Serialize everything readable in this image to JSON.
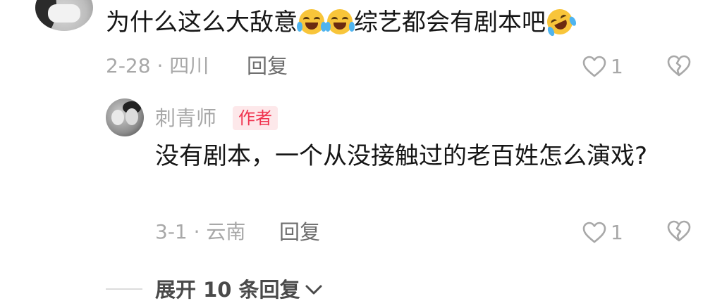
{
  "comment": {
    "text_part1": "为什么这么大敌意",
    "text_part2": "综艺都会有剧本吧",
    "emoji_1": "laughing-tears-emoji",
    "emoji_2": "laughing-tears-emoji",
    "emoji_3": "rolling-laughing-emoji",
    "date_location": "2-28 · 四川",
    "reply_label": "回复",
    "like_count": "1"
  },
  "reply": {
    "author_name": "刺青师",
    "author_badge": "作者",
    "text": "没有剧本，一个从没接触过的老百姓怎么演戏?",
    "date_location": "3-1 · 云南",
    "reply_label": "回复",
    "like_count": "1"
  },
  "expand": {
    "label": "展开 10 条回复"
  },
  "colors": {
    "badge_text": "#f0334f",
    "badge_bg": "#fde8ea",
    "meta_text": "#a8a8a8",
    "body_text": "#161616"
  },
  "icons": {
    "like": "heart-outline-icon",
    "dislike": "broken-heart-icon",
    "expand": "chevron-down-icon"
  }
}
